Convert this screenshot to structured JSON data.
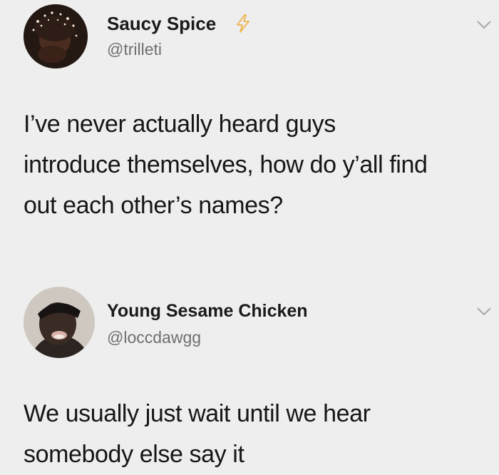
{
  "tweets": [
    {
      "display_name": "Saucy Spice",
      "handle": "@trilleti",
      "badge_icon": "lightning-bolt-icon",
      "menu_icon": "chevron-down-icon",
      "text_lines": [
        "I’ve never actually heard guys",
        "introduce themselves, how do y’all find",
        "out each other’s names?"
      ]
    },
    {
      "display_name": "Young Sesame Chicken",
      "handle": "@loccdawgg",
      "menu_icon": "chevron-down-icon",
      "text_lines": [
        "We usually just wait until we hear",
        "somebody else say it"
      ]
    }
  ],
  "colors": {
    "background": "#eeeeee",
    "handle": "#6f6f6f",
    "badge": "#f5c26b"
  }
}
